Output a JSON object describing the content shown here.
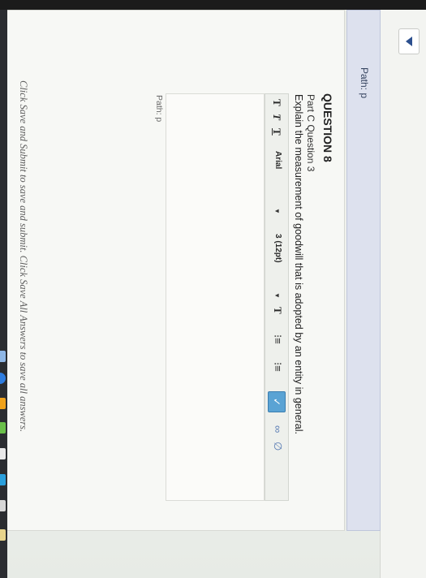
{
  "top_path": {
    "label": "Path: p"
  },
  "question": {
    "title": "QUESTION 8",
    "part": "Part C Question 3",
    "prompt": "Explain the measurement of goodwill that is adopted by an entity in general."
  },
  "toolbar": {
    "bold": "T",
    "italic": "T",
    "underline": "T",
    "font_family": "Arial",
    "font_size": "3 (12pt)",
    "text_color": "T",
    "ordered_list": "⁝≡",
    "unordered_list": "⁝≡",
    "spellcheck": "ABC",
    "link": "🔗",
    "unlink": "⊘"
  },
  "editor": {
    "value": ""
  },
  "bottom_path": {
    "label": "Path: p"
  },
  "footer": {
    "note": "Click Save and Submit to save and submit. Click Save All Answers to save all answers."
  }
}
